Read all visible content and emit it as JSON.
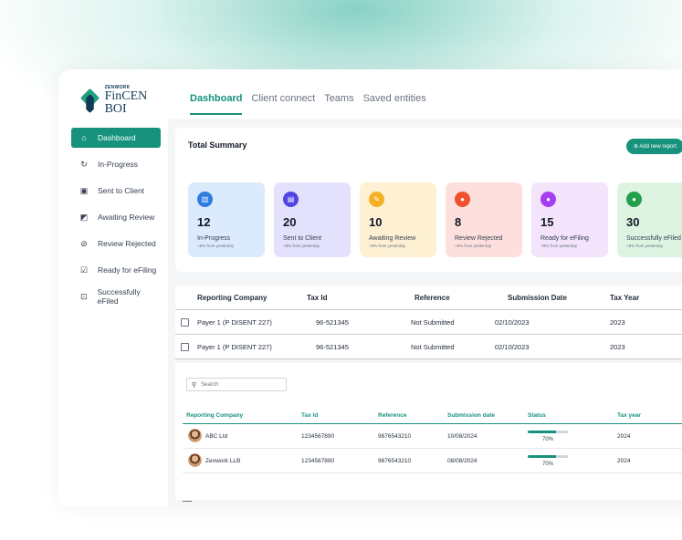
{
  "brand": {
    "sub": "ZENWORK",
    "name": "FinCEN BOI"
  },
  "sidebar": {
    "items": [
      {
        "label": "Dashboard",
        "icon": "home-icon",
        "glyph": "⌂",
        "active": true
      },
      {
        "label": "In-Progress",
        "icon": "progress-icon",
        "glyph": "↻",
        "active": false
      },
      {
        "label": "Sent to Client",
        "icon": "client-card-icon",
        "glyph": "▣",
        "active": false
      },
      {
        "label": "Awaiting Review",
        "icon": "review-icon",
        "glyph": "◩",
        "active": false
      },
      {
        "label": "Review Rejected",
        "icon": "ban-icon",
        "glyph": "⊘",
        "active": false
      },
      {
        "label": "Ready for eFiling",
        "icon": "file-check-icon",
        "glyph": "☑",
        "active": false
      },
      {
        "label": "Successfully eFiled",
        "icon": "efiled-icon",
        "glyph": "⊡",
        "active": false
      }
    ]
  },
  "tabs": [
    {
      "label": "Dashboard",
      "active": true
    },
    {
      "label": "Client connect",
      "active": false
    },
    {
      "label": "Teams",
      "active": false
    },
    {
      "label": "Saved entities",
      "active": false
    }
  ],
  "summary": {
    "title": "Total Summary",
    "add_button": "⊕ Add new report",
    "cards": [
      {
        "value": "12",
        "label": "In-Progress",
        "sub": "+8% from yesterday",
        "bg": "#dceafd",
        "icon_bg": "#2f7de1",
        "icon": "chart-icon",
        "glyph": "▥"
      },
      {
        "value": "20",
        "label": "Sent to Client",
        "sub": "+8% from yesterday",
        "bg": "#e3e1fb",
        "icon_bg": "#4f46e5",
        "icon": "document-icon",
        "glyph": "▤"
      },
      {
        "value": "10",
        "label": "Awaiting Review",
        "sub": "+8% from yesterday",
        "bg": "#fdf0d3",
        "icon_bg": "#f5b025",
        "icon": "pencil-icon",
        "glyph": "✎"
      },
      {
        "value": "8",
        "label": "Review Rejected",
        "sub": "+8% from yesterday",
        "bg": "#fde0dd",
        "icon_bg": "#f0522f",
        "icon": "user-x-icon",
        "glyph": "●"
      },
      {
        "value": "15",
        "label": "Ready for eFiling",
        "sub": "+8% from yesterday",
        "bg": "#f3e3fb",
        "icon_bg": "#a43ef0",
        "icon": "users-icon",
        "glyph": "●"
      },
      {
        "value": "30",
        "label": "Successfully eFiled",
        "sub": "+8% from yesterday",
        "bg": "#ddf4e3",
        "icon_bg": "#22a04b",
        "icon": "user-check-icon",
        "glyph": "●"
      }
    ]
  },
  "table1": {
    "headers": [
      "Reporting Company",
      "Tax Id",
      "Reference",
      "Submission Date",
      "Tax Year"
    ],
    "rows": [
      {
        "company": "Payer 1 (P DISENT 227)",
        "tax_id": "96-521345",
        "reference": "Not Submitted",
        "date": "02/10/2023",
        "year": "2023"
      },
      {
        "company": "Payer 1 (P DISENT 227)",
        "tax_id": "96-521345",
        "reference": "Not Submitted",
        "date": "02/10/2023",
        "year": "2023"
      }
    ]
  },
  "search": {
    "placeholder": "Search"
  },
  "table2": {
    "headers": [
      "Reporting Company",
      "Tax Id",
      "Reference",
      "Submission date",
      "Status",
      "Tax year"
    ],
    "rows": [
      {
        "company": "ABC Ltd",
        "tax_id": "1234567890",
        "reference": "9876543210",
        "date": "10/08/2024",
        "status_pct": "70%",
        "progress": 0.7,
        "year": "2024"
      },
      {
        "company": "Zenwork LLB",
        "tax_id": "1234567890",
        "reference": "9876543210",
        "date": "08/08/2024",
        "status_pct": "70%",
        "progress": 0.7,
        "year": "2024"
      }
    ]
  }
}
